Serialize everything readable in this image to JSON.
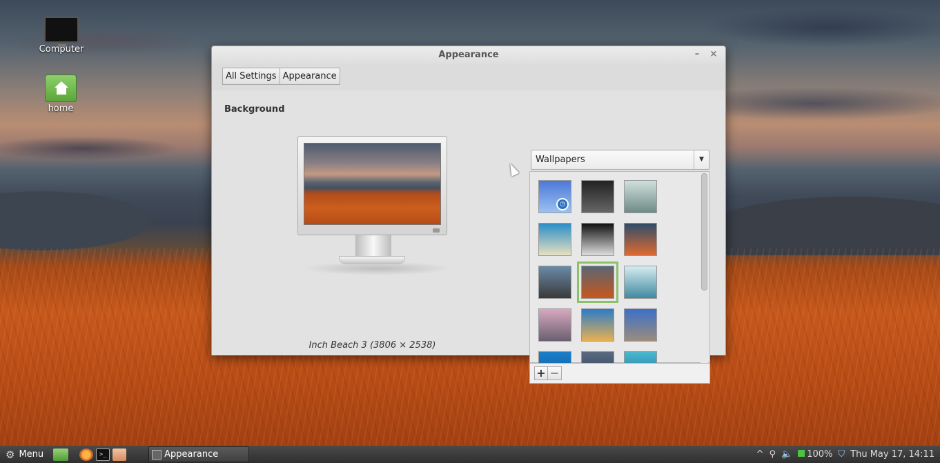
{
  "desktop": {
    "icons": [
      {
        "label": "Computer"
      },
      {
        "label": "home"
      }
    ]
  },
  "window": {
    "title": "Appearance",
    "minimize_glyph": "–",
    "close_glyph": "×",
    "breadcrumb": [
      "All Settings",
      "Appearance"
    ],
    "section_title": "Background",
    "preview_caption": "Inch Beach 3 (3806 × 2538)",
    "dropdown": {
      "selected": "Wallpapers",
      "arrow": "▼"
    },
    "add_glyph": "+",
    "remove_glyph": "−",
    "clock_glyph": "◷",
    "thumbnails": [
      {
        "name": "blue-curtain",
        "selected": false,
        "colors": [
          "#4c78d8",
          "#9cc1f0"
        ]
      },
      {
        "name": "dark-rocks",
        "selected": false,
        "colors": [
          "#222",
          "#666"
        ]
      },
      {
        "name": "misty-sea",
        "selected": false,
        "colors": [
          "#cfe0dc",
          "#6f8a86"
        ]
      },
      {
        "name": "tropical-beach",
        "selected": false,
        "colors": [
          "#2a8ec8",
          "#e8e0c0"
        ]
      },
      {
        "name": "waterfall-bw",
        "selected": false,
        "colors": [
          "#111",
          "#ddd"
        ]
      },
      {
        "name": "sunset-horizon",
        "selected": false,
        "colors": [
          "#2e4c6a",
          "#e06a30"
        ]
      },
      {
        "name": "beach-dusk",
        "selected": false,
        "colors": [
          "#6b8aa8",
          "#3a3a3a"
        ]
      },
      {
        "name": "inch-beach-3",
        "selected": true,
        "colors": [
          "#5a6676",
          "#c8561a"
        ]
      },
      {
        "name": "calm-sea-island",
        "selected": false,
        "colors": [
          "#d6ebf0",
          "#3f8aa0"
        ]
      },
      {
        "name": "pink-pebbles",
        "selected": false,
        "colors": [
          "#d8a8c0",
          "#6a6070"
        ]
      },
      {
        "name": "road-sunset",
        "selected": false,
        "colors": [
          "#2c7cc8",
          "#e8b050"
        ]
      },
      {
        "name": "mountain-town",
        "selected": false,
        "colors": [
          "#3c70c8",
          "#9c8c7c"
        ]
      },
      {
        "name": "blue-ocean",
        "selected": false,
        "colors": [
          "#1a7ec8",
          "#0c5aa0"
        ]
      },
      {
        "name": "storm-clouds",
        "selected": false,
        "colors": [
          "#5a6a80",
          "#2a3a50"
        ]
      },
      {
        "name": "teal-waves",
        "selected": false,
        "colors": [
          "#4ab8d0",
          "#1a6a90"
        ]
      }
    ]
  },
  "taskbar": {
    "menu_label": "Menu",
    "terminal_glyph": ">_",
    "task_label": "Appearance",
    "tray": {
      "up_glyph": "^",
      "battery": "100%",
      "datetime": "Thu May 17, 14:11"
    }
  },
  "colors": {
    "selection": "#8cc069",
    "window_bg": "#dcdcdc"
  }
}
